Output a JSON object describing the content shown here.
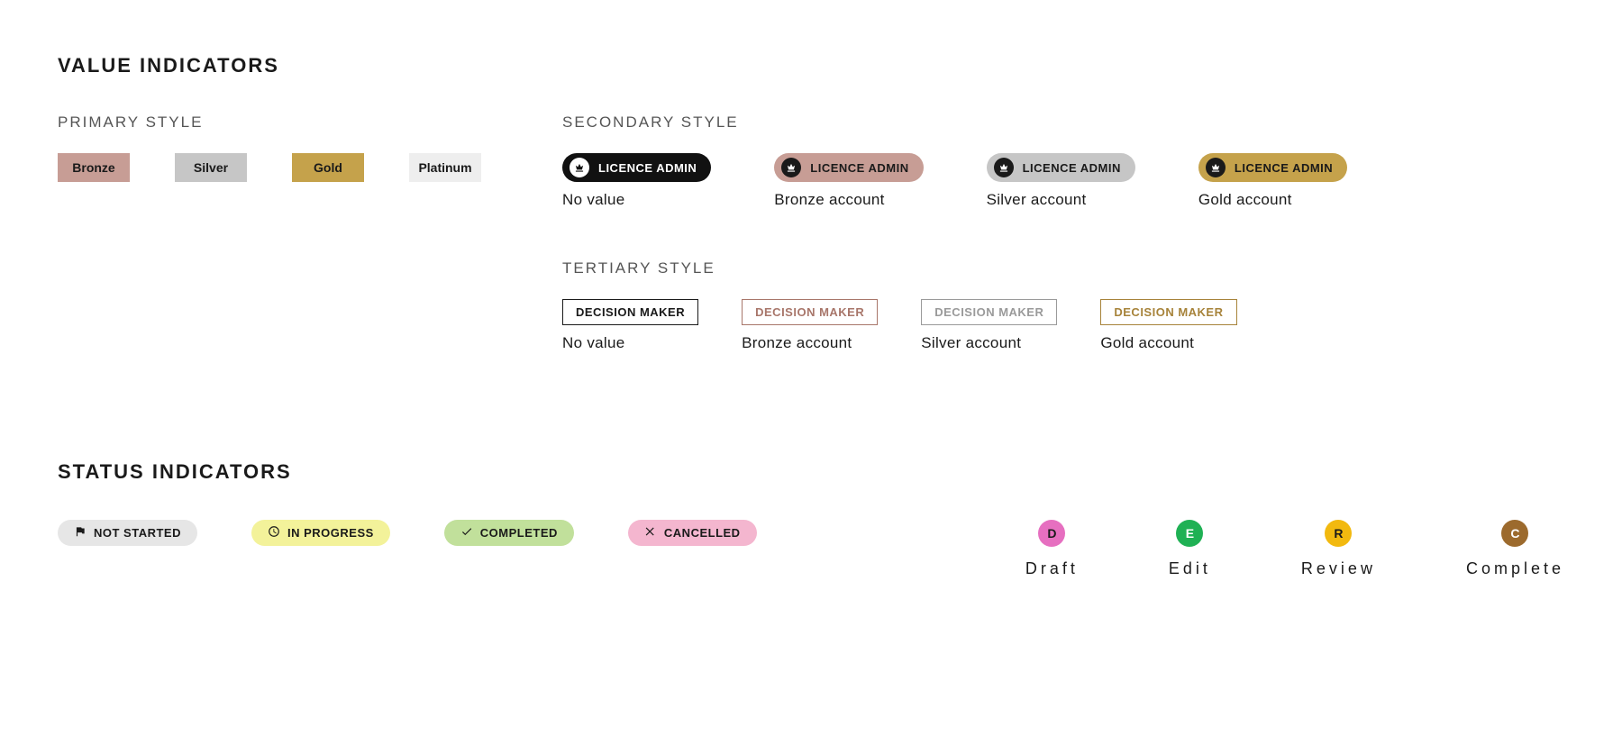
{
  "value_indicators": {
    "title": "VALUE INDICATORS",
    "primary": {
      "label": "PRIMARY STYLE",
      "items": [
        "Bronze",
        "Silver",
        "Gold",
        "Platinum"
      ]
    },
    "secondary": {
      "label": "SECONDARY STYLE",
      "pill_text": "LICENCE ADMIN",
      "items": [
        {
          "caption": "No value"
        },
        {
          "caption": "Bronze account"
        },
        {
          "caption": "Silver account"
        },
        {
          "caption": "Gold account"
        }
      ]
    },
    "tertiary": {
      "label": "TERTIARY STYLE",
      "tag_text": "DECISION MAKER",
      "items": [
        {
          "caption": "No value"
        },
        {
          "caption": "Bronze account"
        },
        {
          "caption": "Silver account"
        },
        {
          "caption": "Gold account"
        }
      ]
    }
  },
  "status_indicators": {
    "title": "STATUS INDICATORS",
    "pills": [
      {
        "label": "NOT STARTED"
      },
      {
        "label": "IN PROGRESS"
      },
      {
        "label": "COMPLETED"
      },
      {
        "label": "CANCELLED"
      }
    ],
    "stages": [
      {
        "letter": "D",
        "label": "Draft"
      },
      {
        "letter": "E",
        "label": "Edit"
      },
      {
        "letter": "R",
        "label": "Review"
      },
      {
        "letter": "C",
        "label": "Complete"
      }
    ]
  },
  "colors": {
    "bronze": "#c79d95",
    "silver": "#c6c6c6",
    "gold": "#c5a24b",
    "platinum": "#eeeeee",
    "notstarted": "#e6e6e6",
    "inprogress": "#f3f29a",
    "completed": "#c1e09b",
    "cancelled": "#f4b6cf",
    "stage_draft": "#e66fc0",
    "stage_edit": "#1fb154",
    "stage_review": "#f2b90f",
    "stage_complete": "#9c6a2d"
  }
}
